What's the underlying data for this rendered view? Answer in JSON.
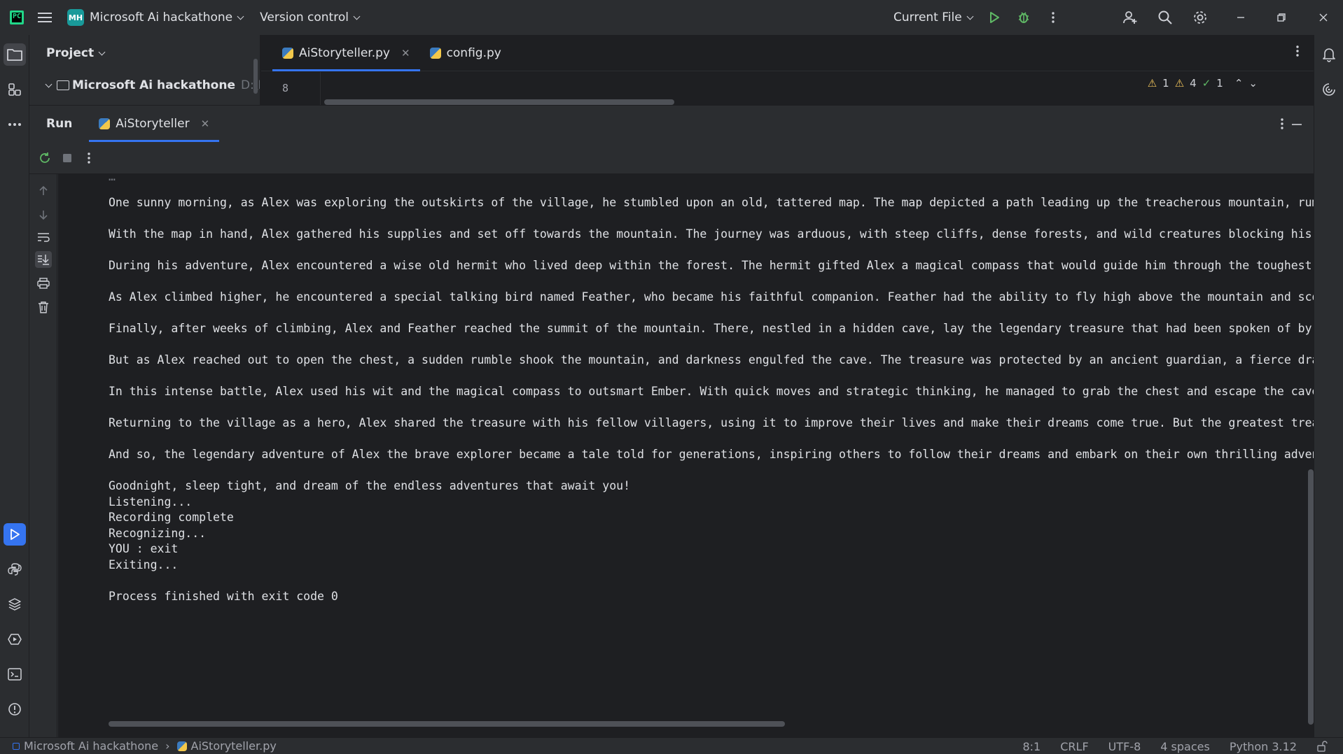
{
  "titlebar": {
    "project_badge": "MH",
    "project_name": "Microsoft Ai hackathone",
    "vcs_label": "Version control",
    "run_config": "Current File"
  },
  "project_panel": {
    "header": "Project",
    "root_name": "Microsoft Ai hackathone",
    "root_path": "D:\\P"
  },
  "editor": {
    "tabs": [
      {
        "label": "AiStoryteller.py",
        "active": true
      },
      {
        "label": "config.py",
        "active": false
      }
    ],
    "visible_line_number": "8",
    "inspections": {
      "warnings_a": "1",
      "warnings_b": "4",
      "ok": "1"
    }
  },
  "run_window": {
    "title": "Run",
    "tab_label": "AiStoryteller",
    "console_lines": [
      "One sunny morning, as Alex was exploring the outskirts of the village, he stumbled upon an old, tattered map. The map depicted a path leading up the treacherous mountain, rumou",
      "With the map in hand, Alex gathered his supplies and set off towards the mountain. The journey was arduous, with steep cliffs, dense forests, and wild creatures blocking his pa",
      "During his adventure, Alex encountered a wise old hermit who lived deep within the forest. The hermit gifted Alex a magical compass that would guide him through the toughest ch",
      "As Alex climbed higher, he encountered a special talking bird named Feather, who became his faithful companion. Feather had the ability to fly high above the mountain and scout",
      "Finally, after weeks of climbing, Alex and Feather reached the summit of the mountain. There, nestled in a hidden cave, lay the legendary treasure that had been spoken of by ge",
      "But as Alex reached out to open the chest, a sudden rumble shook the mountain, and darkness engulfed the cave. The treasure was protected by an ancient guardian, a fierce drago",
      "In this intense battle, Alex used his wit and the magical compass to outsmart Ember. With quick moves and strategic thinking, he managed to grab the chest and escape the cave j",
      "Returning to the village as a hero, Alex shared the treasure with his fellow villagers, using it to improve their lives and make their dreams come true. But the greatest treasu",
      "And so, the legendary adventure of Alex the brave explorer became a tale told for generations, inspiring others to follow their dreams and embark on their own thrilling adventu",
      "Goodnight, sleep tight, and dream of the endless adventures that await you!",
      "Listening...",
      "Recording complete",
      "Recognizing...",
      "YOU : exit",
      "Exiting...",
      "Process finished with exit code 0"
    ]
  },
  "statusbar": {
    "breadcrumb_project": "Microsoft Ai hackathone",
    "breadcrumb_file": "AiStoryteller.py",
    "position": "8:1",
    "line_sep": "CRLF",
    "encoding": "UTF-8",
    "indent": "4 spaces",
    "interpreter": "Python 3.12"
  },
  "colors": {
    "accent": "#3574f0",
    "background": "#1e1f22",
    "panel": "#2b2d30",
    "run_green": "#5fb865",
    "warning": "#f2c55c"
  }
}
